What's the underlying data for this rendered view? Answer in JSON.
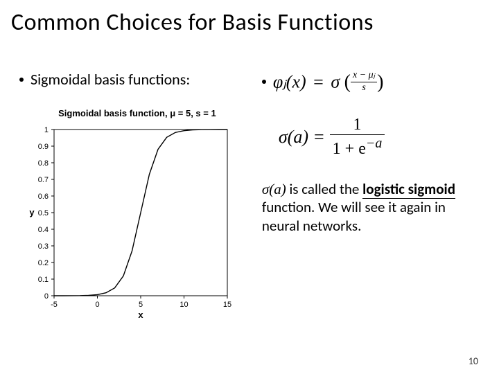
{
  "title": "Common Choices for Basis Functions",
  "bullet": "Sigmoidal basis functions:",
  "formula1": {
    "lhs": "φⱼ(x)",
    "eq": "=",
    "sigma": "σ",
    "num": "x − μⱼ",
    "den": "s"
  },
  "formula2": {
    "lhs": "σ(a)",
    "eq": "=",
    "num": "1",
    "den_prefix": "1 + e",
    "den_exp": "−a"
  },
  "note": {
    "t1": "σ(a)",
    "t2": " is called the ",
    "t3": "logistic sigmoid",
    "t4": " function. We will see it again in neural networks."
  },
  "page_number": "10",
  "chart_data": {
    "type": "line",
    "title": "Sigmoidal basis function, μ = 5, s = 1",
    "xlabel": "x",
    "ylabel": "y",
    "xlim": [
      -5,
      15
    ],
    "ylim": [
      0,
      1
    ],
    "xticks": [
      -5,
      0,
      5,
      10,
      15
    ],
    "yticks": [
      0,
      0.1,
      0.2,
      0.3,
      0.4,
      0.5,
      0.6,
      0.7,
      0.8,
      0.9,
      1
    ],
    "x": [
      -5,
      -4,
      -3,
      -2,
      -1,
      0,
      1,
      2,
      3,
      4,
      5,
      6,
      7,
      8,
      9,
      10,
      11,
      12,
      13,
      14,
      15
    ],
    "y": [
      0.0,
      0.0001,
      0.0003,
      0.0009,
      0.0025,
      0.0067,
      0.018,
      0.047,
      0.119,
      0.269,
      0.5,
      0.731,
      0.881,
      0.953,
      0.982,
      0.993,
      0.998,
      0.999,
      0.9997,
      0.9999,
      1.0
    ]
  }
}
